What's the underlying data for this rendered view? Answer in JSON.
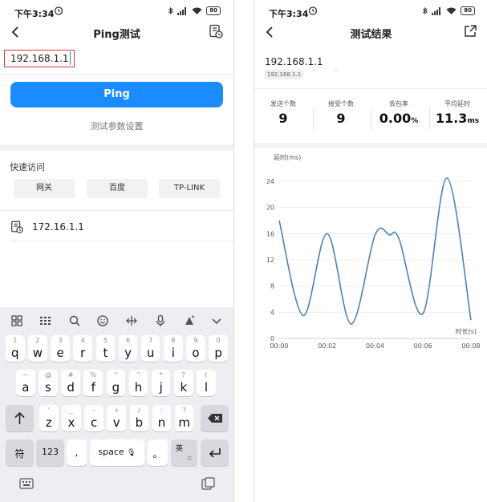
{
  "status": {
    "time": "下午3:34",
    "battery": "80"
  },
  "left": {
    "title": "Ping测试",
    "ip_value": "192.168.1.1",
    "ping_label": "Ping",
    "params_label": "测试参数设置",
    "quick_title": "快速访问",
    "quick_items": [
      "网关",
      "百度",
      "TP-LINK"
    ],
    "history_item": "172.16.1.1",
    "keyboard": {
      "rows": [
        [
          {
            "k": "q",
            "s": "1"
          },
          {
            "k": "w",
            "s": "2"
          },
          {
            "k": "e",
            "s": "3"
          },
          {
            "k": "r",
            "s": "4"
          },
          {
            "k": "t",
            "s": "5"
          },
          {
            "k": "y",
            "s": "6"
          },
          {
            "k": "u",
            "s": "7"
          },
          {
            "k": "i",
            "s": "8"
          },
          {
            "k": "o",
            "s": "9"
          },
          {
            "k": "p",
            "s": "0"
          }
        ],
        [
          {
            "k": "a",
            "s": "~"
          },
          {
            "k": "s",
            "s": "@"
          },
          {
            "k": "d",
            "s": "#"
          },
          {
            "k": "f",
            "s": "%"
          },
          {
            "k": "g",
            "s": "\""
          },
          {
            "k": "h",
            "s": "\""
          },
          {
            "k": "j",
            "s": "*"
          },
          {
            "k": "k",
            "s": "?"
          },
          {
            "k": "l",
            "s": "("
          }
        ],
        [
          {
            "k": "z",
            "s": "'"
          },
          {
            "k": "x",
            "s": "_"
          },
          {
            "k": "c",
            "s": "-"
          },
          {
            "k": "v",
            "s": "+"
          },
          {
            "k": "b",
            "s": "/"
          },
          {
            "k": "n",
            "s": ":"
          },
          {
            "k": "m",
            "s": "?"
          }
        ]
      ],
      "symbol_key": "符",
      "num_key": "123",
      "comma_key": ",",
      "space_key": "space",
      "period_key": "。",
      "lang_key": "英",
      "lang_sub": "中"
    }
  },
  "right": {
    "title": "测试结果",
    "ip": "192.168.1.1",
    "ip_chip": "192.168.1.1",
    "stats": [
      {
        "label": "发送个数",
        "value": "9",
        "unit": ""
      },
      {
        "label": "接受个数",
        "value": "9",
        "unit": ""
      },
      {
        "label": "丢包率",
        "value": "0.00",
        "unit": "%"
      },
      {
        "label": "平均延时",
        "value": "11.3",
        "unit": "ms"
      }
    ]
  },
  "chart_data": {
    "type": "line",
    "ylabel": "延时(ms)",
    "xlabel": "时长(s)",
    "ylim": [
      0,
      24
    ],
    "yticks": [
      0,
      4,
      8,
      12,
      16,
      20,
      24
    ],
    "xticks": [
      "00:00",
      "00:02",
      "00:04",
      "00:06",
      "00:08"
    ],
    "xlim": [
      0,
      8
    ],
    "series": [
      {
        "x": [
          0,
          1,
          2,
          3,
          4,
          4.6,
          5,
          6,
          7,
          8
        ],
        "values": [
          18,
          3.5,
          16,
          2.2,
          15.8,
          15.8,
          15.2,
          3.8,
          24.5,
          2.8
        ]
      }
    ],
    "line_color": "#4a82b8",
    "grid": true
  },
  "colors": {
    "accent": "#1a8cff",
    "highlight_border": "#d23a3a"
  }
}
